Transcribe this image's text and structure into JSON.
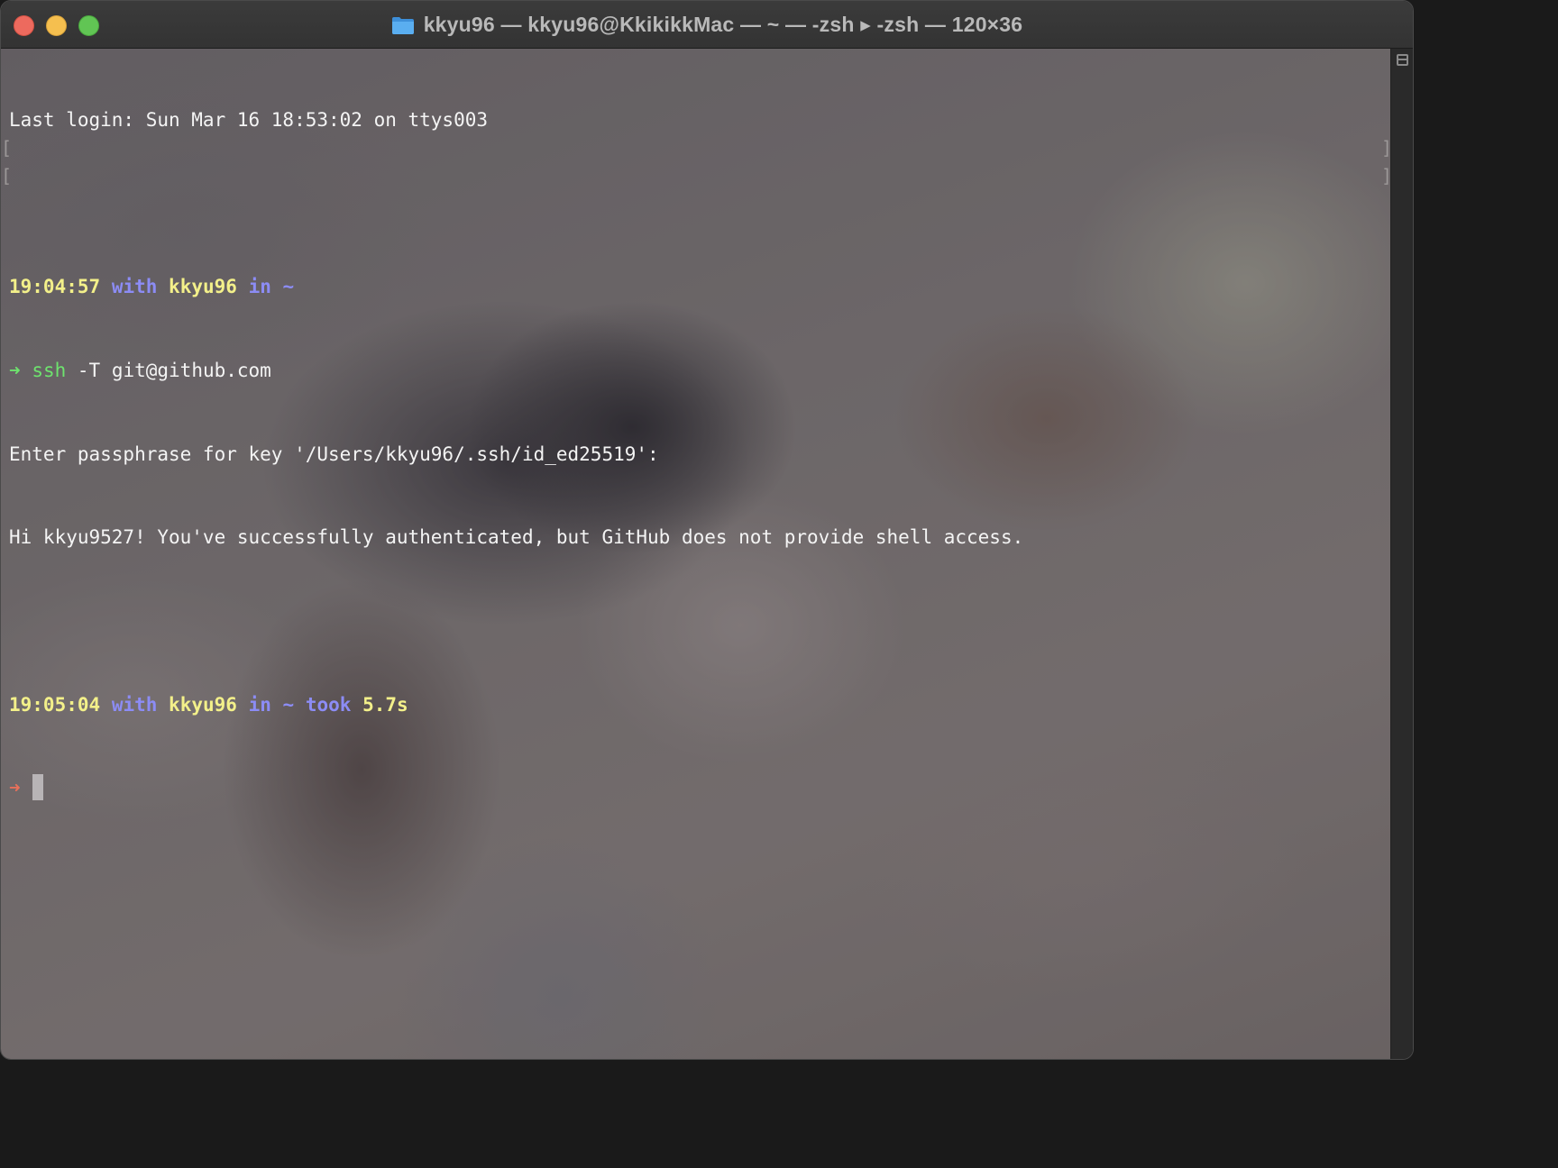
{
  "window": {
    "title": "kkyu96 — kkyu96@KkikikkMac — ~ — -zsh ▸ -zsh — 120×36",
    "folder_icon": "folder-icon",
    "traffic_lights": {
      "close": "#ed6a5e",
      "minimize": "#f5bf4f",
      "maximize": "#61c554"
    }
  },
  "terminal": {
    "last_login": "Last login: Sun Mar 16 18:53:02 on ttys003",
    "prompt1": {
      "time": "19:04:57",
      "with": "with",
      "user": "kkyu96",
      "in": "in",
      "dir": "~"
    },
    "command": {
      "arrow": "➜",
      "program": "ssh",
      "args": " -T git@github.com"
    },
    "output": [
      "Enter passphrase for key '/Users/kkyu96/.ssh/id_ed25519':",
      "Hi kkyu9527! You've successfully authenticated, but GitHub does not provide shell access."
    ],
    "prompt2": {
      "time": "19:05:04",
      "with": "with",
      "user": "kkyu96",
      "in": "in",
      "dir": "~",
      "took": "took",
      "duration": "5.7s"
    },
    "current_arrow": "➜"
  },
  "colors": {
    "time": "#f3f08a",
    "keyword": "#8c8cf5",
    "success_arrow": "#6ee36e",
    "error_arrow": "#e8705a"
  }
}
